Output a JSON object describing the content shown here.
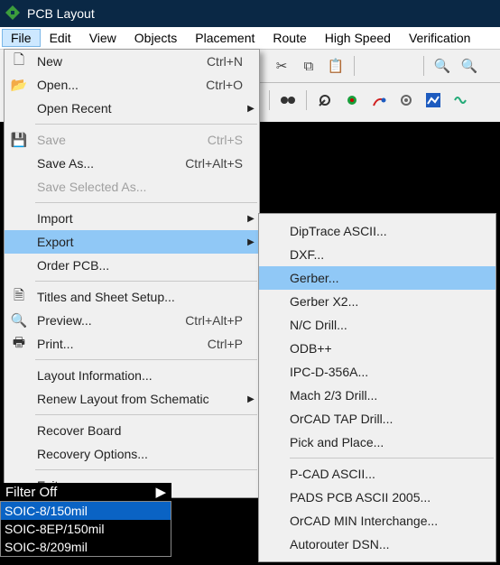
{
  "title": "PCB Layout",
  "menubar": [
    "File",
    "Edit",
    "View",
    "Objects",
    "Placement",
    "Route",
    "High Speed",
    "Verification"
  ],
  "active_menu_index": 0,
  "file_menu": {
    "new": {
      "label": "New",
      "shortcut": "Ctrl+N"
    },
    "open": {
      "label": "Open...",
      "shortcut": "Ctrl+O"
    },
    "recent": {
      "label": "Open Recent"
    },
    "save": {
      "label": "Save",
      "shortcut": "Ctrl+S"
    },
    "saveas": {
      "label": "Save As...",
      "shortcut": "Ctrl+Alt+S"
    },
    "savesel": {
      "label": "Save Selected As..."
    },
    "import": {
      "label": "Import"
    },
    "export": {
      "label": "Export"
    },
    "order": {
      "label": "Order PCB..."
    },
    "titles": {
      "label": "Titles and Sheet Setup..."
    },
    "preview": {
      "label": "Preview...",
      "shortcut": "Ctrl+Alt+P"
    },
    "print": {
      "label": "Print...",
      "shortcut": "Ctrl+P"
    },
    "layoutinfo": {
      "label": "Layout Information..."
    },
    "renew": {
      "label": "Renew Layout from Schematic"
    },
    "recover": {
      "label": "Recover Board"
    },
    "recopts": {
      "label": "Recovery Options..."
    },
    "exit": {
      "label": "Exit"
    }
  },
  "export_menu": [
    "DipTrace ASCII...",
    "DXF...",
    "Gerber...",
    "Gerber X2...",
    "N/C Drill...",
    "ODB++",
    "IPC-D-356A...",
    "Mach 2/3 Drill...",
    "OrCAD TAP Drill...",
    "Pick and Place...",
    "__sep__",
    "P-CAD ASCII...",
    "PADS PCB ASCII 2005...",
    "OrCAD MIN Interchange...",
    "Autorouter DSN..."
  ],
  "export_selected_index": 2,
  "filter_label": "Filter Off",
  "component_list": [
    "SOIC-8/150mil",
    "SOIC-8EP/150mil",
    "SOIC-8/209mil"
  ],
  "component_selected_index": 0
}
